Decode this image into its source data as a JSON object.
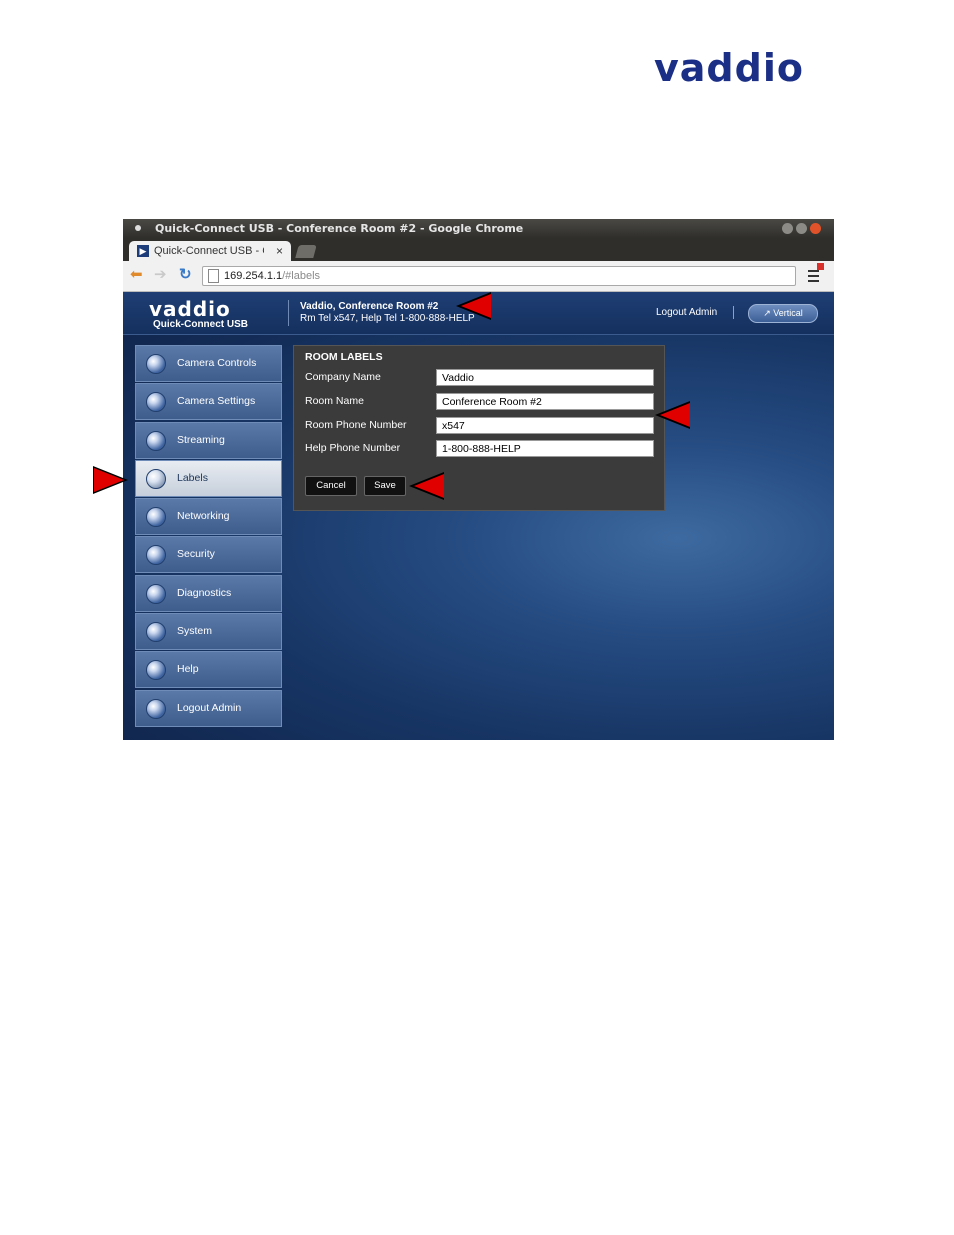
{
  "page_logo": {
    "text": "vaddio",
    "color": "#1b2f86"
  },
  "window": {
    "title": "Quick-Connect USB - Conference Room #2 - Google Chrome",
    "tab_label": "Quick-Connect USB - C",
    "tab_close": "×",
    "url_host": "169.254.1.1",
    "url_path": "/#labels"
  },
  "app": {
    "logo": "vaddio",
    "subtitle": "Quick-Connect USB",
    "room_title": "Vaddio, Conference Room #2",
    "room_sub": "Rm Tel x547, Help Tel 1-800-888-HELP",
    "logout_link": "Logout Admin",
    "vertical_button": "Vertical"
  },
  "sidebar": {
    "items": [
      {
        "label": "Camera Controls",
        "icon": "camera-controls-icon",
        "active": false
      },
      {
        "label": "Camera Settings",
        "icon": "camera-settings-icon",
        "active": false
      },
      {
        "label": "Streaming",
        "icon": "streaming-icon",
        "active": false
      },
      {
        "label": "Labels",
        "icon": "labels-icon",
        "active": true
      },
      {
        "label": "Networking",
        "icon": "networking-icon",
        "active": false
      },
      {
        "label": "Security",
        "icon": "lock-icon",
        "active": false
      },
      {
        "label": "Diagnostics",
        "icon": "diagnostics-icon",
        "active": false
      },
      {
        "label": "System",
        "icon": "gear-icon",
        "active": false
      },
      {
        "label": "Help",
        "icon": "info-icon",
        "active": false
      },
      {
        "label": "Logout Admin",
        "icon": "power-icon",
        "active": false
      }
    ]
  },
  "room_labels": {
    "title": "ROOM LABELS",
    "fields": [
      {
        "label": "Company Name",
        "value": "Vaddio"
      },
      {
        "label": "Room Name",
        "value": "Conference Room #2"
      },
      {
        "label": "Room Phone Number",
        "value": "x547"
      },
      {
        "label": "Help Phone Number",
        "value": "1-800-888-HELP"
      }
    ],
    "cancel_label": "Cancel",
    "save_label": "Save"
  },
  "colors": {
    "accent_arrow": "#e00000",
    "panel_bg": "#3b3b3b",
    "header_bg": "#1f3e74"
  }
}
